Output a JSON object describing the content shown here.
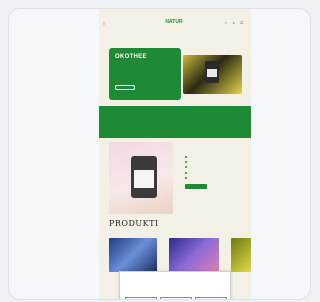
{
  "header": {
    "menu_label": "≡",
    "logo_text": "NATUR",
    "icons": [
      "search-icon",
      "user-icon",
      "cart-icon"
    ],
    "icons_text": "⌕ ♙ ⊡"
  },
  "hero": {
    "title": "OKOTHEE",
    "subtitle": "",
    "button_label": ""
  },
  "band": {
    "text": ""
  },
  "features": {
    "items": [
      "",
      "",
      "",
      "",
      ""
    ],
    "cta_label": ""
  },
  "products": {
    "heading": "PRODUKTI"
  },
  "cookie": {
    "title": "",
    "text": "",
    "buttons": [
      "",
      "",
      ""
    ]
  },
  "colors": {
    "brand_green": "#1f8a35",
    "page_bg": "#f3f0e6"
  }
}
